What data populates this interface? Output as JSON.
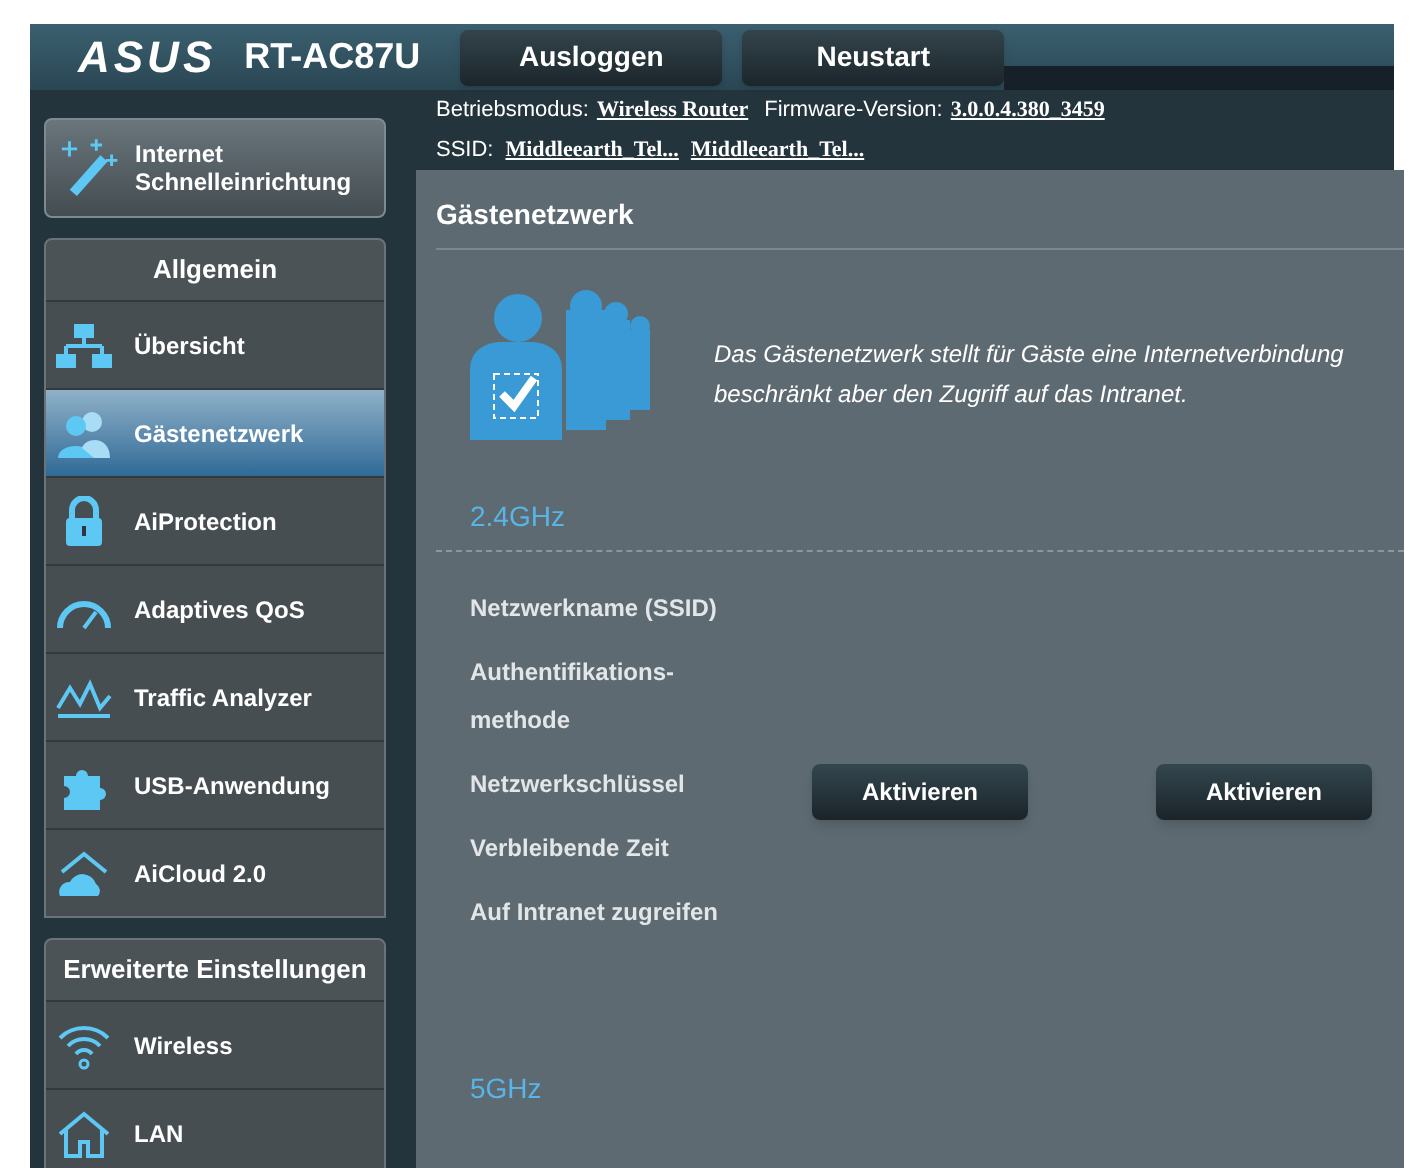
{
  "header": {
    "brand": "ASUS",
    "model": "RT-AC87U",
    "buttons": [
      "Ausloggen",
      "Neustart"
    ]
  },
  "info": {
    "mode_label": "Betriebsmodus:",
    "mode_value": "Wireless Router",
    "firmware_label": "Firmware-Version:",
    "firmware_value": "3.0.0.4.380_3459",
    "ssid_label": "SSID:",
    "ssids": [
      "Middleearth_Tel...",
      "Middleearth_Tel..."
    ]
  },
  "quick_setup": {
    "label": "Internet Schnelleinrichtung"
  },
  "sidebar": [
    {
      "title": "Allgemein",
      "items": [
        {
          "label": "Übersicht",
          "selected": false
        },
        {
          "label": "Gästenetzwerk",
          "selected": true
        },
        {
          "label": "AiProtection",
          "selected": false
        },
        {
          "label": "Adaptives QoS",
          "selected": false
        },
        {
          "label": "Traffic Analyzer",
          "selected": false
        },
        {
          "label": "USB-Anwendung",
          "selected": false
        },
        {
          "label": "AiCloud 2.0",
          "selected": false
        }
      ]
    },
    {
      "title": "Erweiterte Einstellungen",
      "items": [
        {
          "label": "Wireless",
          "selected": false
        },
        {
          "label": "LAN",
          "selected": false
        }
      ]
    }
  ],
  "main": {
    "title": "Gästenetzwerk",
    "description": "Das Gästenetzwerk stellt für Gäste eine Internetverbindung beschränkt aber den Zugriff auf das Intranet.",
    "band": "2.4GHz",
    "fields": [
      "Netzwerkname (SSID)",
      "Authentifikations- methode",
      "Netzwerkschlüssel",
      "Verbleibende Zeit",
      "Auf Intranet zugreifen"
    ],
    "buttons": [
      "Aktivieren",
      "Aktivieren"
    ],
    "band_2": "5GHz"
  }
}
